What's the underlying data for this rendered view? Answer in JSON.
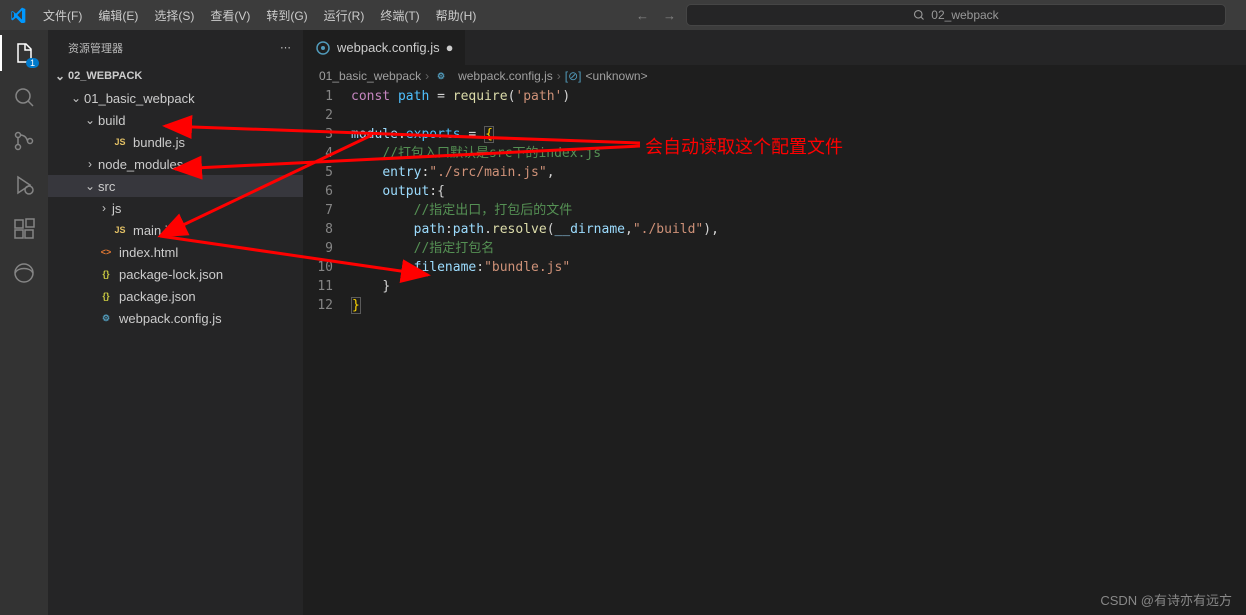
{
  "menu": [
    "文件(F)",
    "编辑(E)",
    "选择(S)",
    "查看(V)",
    "转到(G)",
    "运行(R)",
    "终端(T)",
    "帮助(H)"
  ],
  "commandCenter": {
    "icon": "search",
    "text": "02_webpack"
  },
  "sidebar": {
    "title": "资源管理器",
    "rootProject": "02_WEBPACK",
    "tree": [
      {
        "indent": 1,
        "expand": "open",
        "type": "folder",
        "label": "01_basic_webpack"
      },
      {
        "indent": 2,
        "expand": "open",
        "type": "folder",
        "label": "build"
      },
      {
        "indent": 3,
        "expand": "none",
        "type": "js",
        "label": "bundle.js"
      },
      {
        "indent": 2,
        "expand": "closed",
        "type": "folder",
        "label": "node_modules"
      },
      {
        "indent": 2,
        "expand": "open",
        "type": "folder",
        "label": "src",
        "selected": true
      },
      {
        "indent": 3,
        "expand": "closed",
        "type": "folder",
        "label": "js"
      },
      {
        "indent": 3,
        "expand": "none",
        "type": "js",
        "label": "main.js"
      },
      {
        "indent": 2,
        "expand": "none",
        "type": "html",
        "label": "index.html"
      },
      {
        "indent": 2,
        "expand": "none",
        "type": "json",
        "label": "package-lock.json"
      },
      {
        "indent": 2,
        "expand": "none",
        "type": "json",
        "label": "package.json"
      },
      {
        "indent": 2,
        "expand": "none",
        "type": "gear",
        "label": "webpack.config.js"
      }
    ]
  },
  "tabs": [
    {
      "icon": "gear",
      "label": "webpack.config.js",
      "dirty": true
    }
  ],
  "breadcrumb": [
    "01_basic_webpack",
    "webpack.config.js",
    "<unknown>"
  ],
  "breadcrumbIcons": [
    "",
    "gear",
    "brackets"
  ],
  "code": {
    "lines": [
      [
        {
          "c": "tok-key",
          "t": "const"
        },
        {
          "c": "tok-punc",
          "t": " "
        },
        {
          "c": "tok-var",
          "t": "path"
        },
        {
          "c": "tok-punc",
          "t": " = "
        },
        {
          "c": "tok-func",
          "t": "require"
        },
        {
          "c": "tok-punc",
          "t": "("
        },
        {
          "c": "tok-str",
          "t": "'path'"
        },
        {
          "c": "tok-punc",
          "t": ")"
        }
      ],
      [],
      [
        {
          "c": "tok-ident",
          "t": "module"
        },
        {
          "c": "tok-punc",
          "t": "."
        },
        {
          "c": "tok-var",
          "t": "exports"
        },
        {
          "c": "tok-punc",
          "t": " = "
        },
        {
          "c": "tok-brace cursor-bracket",
          "t": "{"
        }
      ],
      [
        {
          "t": "    "
        },
        {
          "c": "tok-comm",
          "t": "//打包入口默认是src下的index.js"
        }
      ],
      [
        {
          "t": "    "
        },
        {
          "c": "tok-ident",
          "t": "entry"
        },
        {
          "c": "tok-punc",
          "t": ":"
        },
        {
          "c": "tok-str",
          "t": "\"./src/main.js\""
        },
        {
          "c": "tok-punc",
          "t": ","
        }
      ],
      [
        {
          "t": "    "
        },
        {
          "c": "tok-ident",
          "t": "output"
        },
        {
          "c": "tok-punc",
          "t": ":{"
        }
      ],
      [
        {
          "t": "        "
        },
        {
          "c": "tok-comm",
          "t": "//指定出口，打包后的文件"
        }
      ],
      [
        {
          "t": "        "
        },
        {
          "c": "tok-ident",
          "t": "path"
        },
        {
          "c": "tok-punc",
          "t": ":"
        },
        {
          "c": "tok-ident",
          "t": "path"
        },
        {
          "c": "tok-punc",
          "t": "."
        },
        {
          "c": "tok-func",
          "t": "resolve"
        },
        {
          "c": "tok-punc",
          "t": "("
        },
        {
          "c": "tok-ident",
          "t": "__dirname"
        },
        {
          "c": "tok-punc",
          "t": ","
        },
        {
          "c": "tok-str",
          "t": "\"./build\""
        },
        {
          "c": "tok-punc",
          "t": "),"
        }
      ],
      [
        {
          "t": "        "
        },
        {
          "c": "tok-comm",
          "t": "//指定打包名"
        }
      ],
      [
        {
          "t": "        "
        },
        {
          "c": "tok-ident",
          "t": "filename"
        },
        {
          "c": "tok-punc",
          "t": ":"
        },
        {
          "c": "tok-str",
          "t": "\"bundle.js\""
        }
      ],
      [
        {
          "t": "    "
        },
        {
          "c": "tok-punc",
          "t": "}"
        }
      ],
      [
        {
          "c": "tok-brace cursor-bracket",
          "t": "}"
        }
      ]
    ]
  },
  "annotation": "会自动读取这个配置文件",
  "activityBadge": "1",
  "watermark": "CSDN @有诗亦有远方"
}
